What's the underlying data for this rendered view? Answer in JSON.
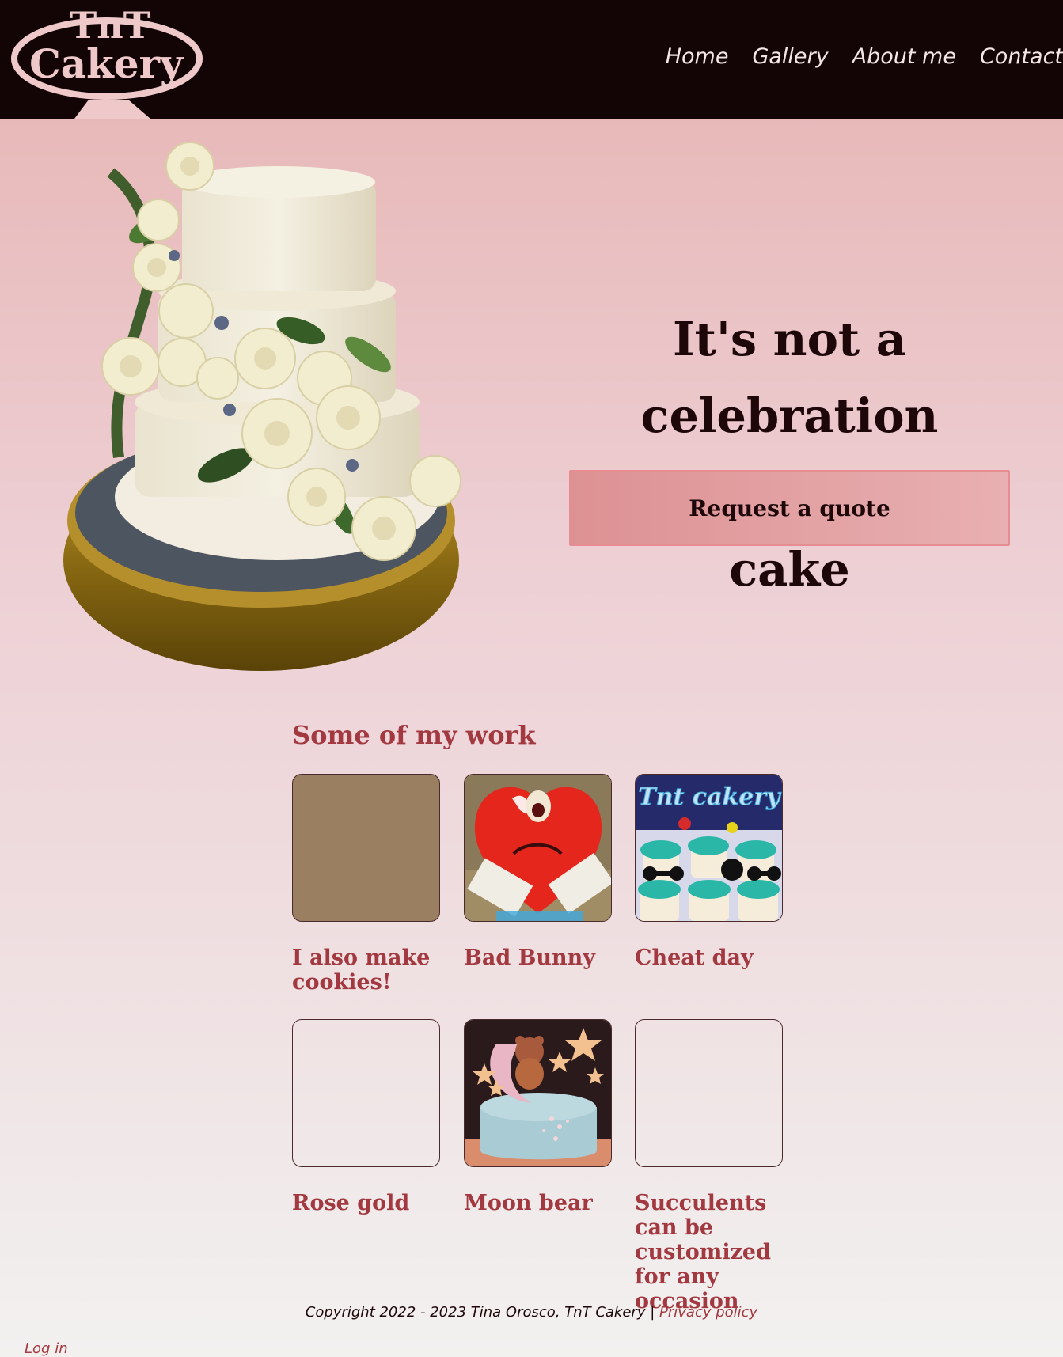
{
  "brand": {
    "line1": "TnT",
    "line2": "Cakery"
  },
  "nav": [
    {
      "label": "Home"
    },
    {
      "label": "Gallery"
    },
    {
      "label": "About me"
    },
    {
      "label": "Contact"
    }
  ],
  "hero": {
    "title_line1": "It's not a celebration",
    "title_line2": "until there is cake",
    "cta_label": "Request a quote"
  },
  "work": {
    "title": "Some of my work",
    "items": [
      {
        "caption": "I also make cookies!",
        "image": "placeholder-tan"
      },
      {
        "caption": "Bad Bunny",
        "image": "red-heart-cake"
      },
      {
        "caption": "Cheat day",
        "image": "fitness-cupcakes",
        "overlay_text": "Tnt cakery"
      },
      {
        "caption": "Rose gold",
        "image": "blank"
      },
      {
        "caption": "Moon bear",
        "image": "moon-bear-cake"
      },
      {
        "caption": "Succulents can be customized for any occasion",
        "image": "blank"
      }
    ]
  },
  "footer": {
    "copyright": "Copyright 2022 - 2023 Tina Orosco, TnT Cakery | ",
    "privacy_label": "Privacy policy",
    "login_label": "Log in"
  },
  "colors": {
    "header_bg": "#130506",
    "accent": "#a33940",
    "button": "#dd9193",
    "logo": "#efc9c9"
  }
}
